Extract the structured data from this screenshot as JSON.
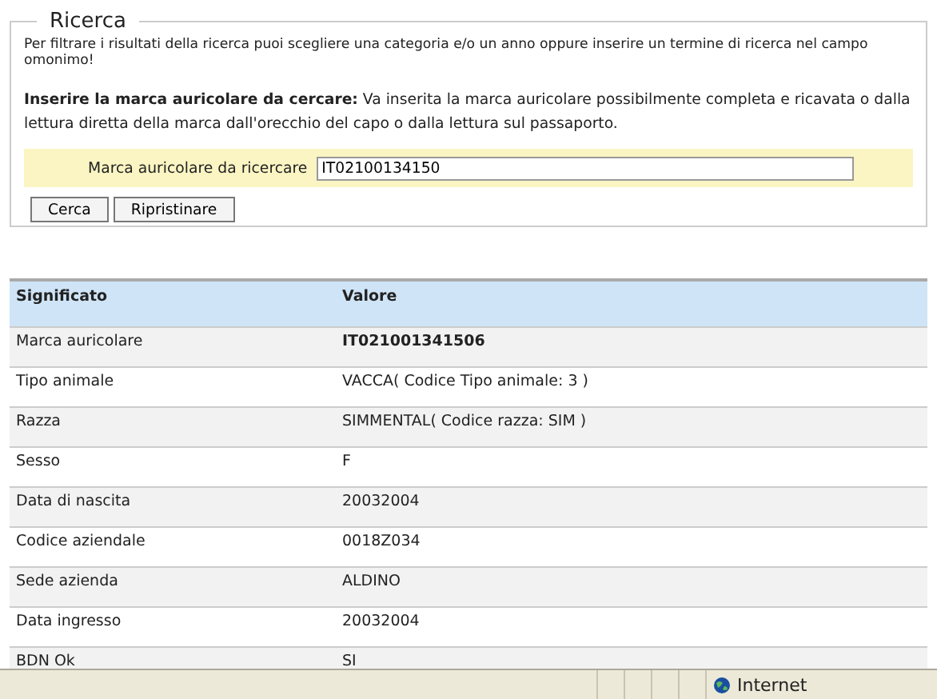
{
  "search_panel": {
    "legend": "Ricerca",
    "intro": "Per filtrare i risultati della ricerca puoi scegliere una categoria e/o un anno oppure inserire un termine di ricerca nel campo omonimo!",
    "instructions": "**Inserire la marca auricolare da cercare:** Va inserita la marca auricolare possibilmente completa e ricavata o dalla lettura diretta della marca dall'orecchio del capo o dalla lettura sul passaporto.",
    "field_label": "Marca auricolare da ricercare",
    "field_value": "IT02100134150",
    "buttons": [
      "Cerca",
      "Ripristinare"
    ]
  },
  "table": {
    "columns": [
      "Significato",
      "Valore"
    ],
    "rows": [
      {
        "label": "Marca auricolare",
        "value": "IT021001341506",
        "bold": true
      },
      {
        "label": "Tipo animale",
        "value": "VACCA( Codice Tipo animale: 3 )",
        "bold": false
      },
      {
        "label": "Razza",
        "value": "SIMMENTAL( Codice razza: SIM )",
        "bold": false
      },
      {
        "label": "Sesso",
        "value": "F",
        "bold": false
      },
      {
        "label": "Data di nascita",
        "value": "20032004",
        "bold": false
      },
      {
        "label": "Codice aziendale",
        "value": "0018Z034",
        "bold": false
      },
      {
        "label": "Sede azienda",
        "value": "ALDINO",
        "bold": false
      },
      {
        "label": "Data ingresso",
        "value": "20032004",
        "bold": false
      },
      {
        "label": "BDN Ok",
        "value": "SI",
        "bold": false
      }
    ]
  },
  "status_bar": {
    "zone": "Internet"
  }
}
